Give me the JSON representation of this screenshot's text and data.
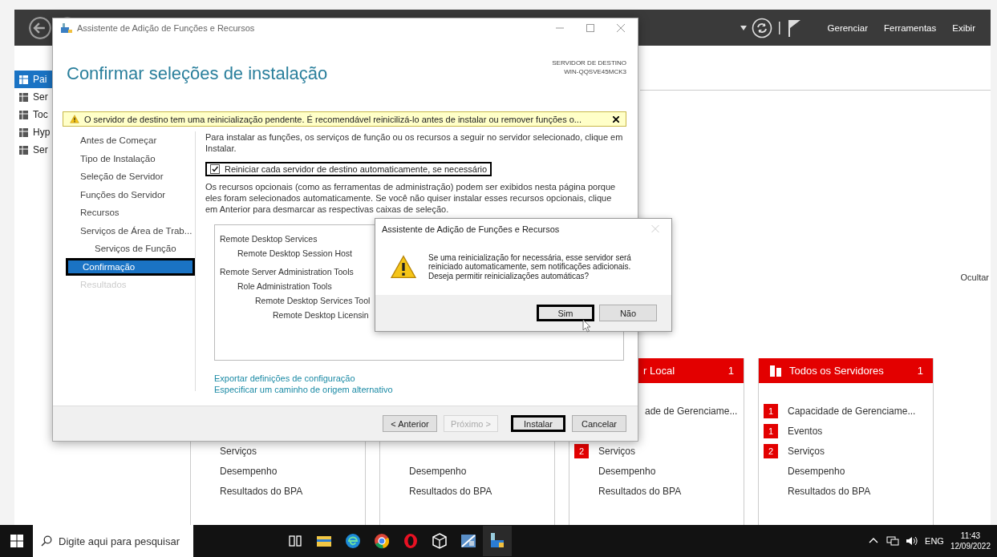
{
  "server_manager": {
    "menu": [
      "Gerenciar",
      "Ferramentas",
      "Exibir"
    ],
    "sidebar_items": [
      {
        "label": "Pai",
        "selected": true
      },
      {
        "label": "Ser",
        "selected": false
      },
      {
        "label": "Toc",
        "selected": false
      },
      {
        "label": "Hyp",
        "selected": false
      },
      {
        "label": "Ser",
        "selected": false
      }
    ],
    "hide_label": "Ocultar",
    "tiles": [
      {
        "rows": [
          {
            "label": "Serviços"
          },
          {
            "label": "Desempenho"
          },
          {
            "label": "Resultados do BPA"
          }
        ]
      },
      {
        "rows": [
          {
            "label": "Desempenho"
          },
          {
            "label": "Resultados do BPA"
          }
        ]
      },
      {
        "title": "r Local",
        "count": "1",
        "cut": true,
        "rows": [
          {
            "label": "ade de Gerenciame...",
            "cut": true
          },
          {
            "label": "Serviços",
            "count": "2"
          },
          {
            "label": "Desempenho"
          },
          {
            "label": "Resultados do BPA"
          }
        ]
      },
      {
        "title": "Todos os Servidores",
        "count": "1",
        "cut": false,
        "rows": [
          {
            "label": "Capacidade de Gerenciame...",
            "count": "1"
          },
          {
            "label": "Eventos",
            "count": "1"
          },
          {
            "label": "Serviços",
            "count": "2"
          },
          {
            "label": "Desempenho"
          },
          {
            "label": "Resultados do BPA"
          }
        ]
      }
    ]
  },
  "wizard": {
    "title": "Assistente de Adição de Funções e Recursos",
    "heading": "Confirmar seleções de instalação",
    "destination_label": "SERVIDOR DE DESTINO",
    "destination_server": "WIN-QQSVE45MCK3",
    "warning": "O servidor de destino tem uma reinicialização pendente. É recomendável reinicilizá-lo antes de instalar ou remover funções o...",
    "nav": [
      {
        "label": "Antes de Começar",
        "selected": false,
        "disabled": false,
        "highlighted": false
      },
      {
        "label": "Tipo de Instalação",
        "selected": false,
        "disabled": false,
        "highlighted": false
      },
      {
        "label": "Seleção de Servidor",
        "selected": false,
        "disabled": false,
        "highlighted": false
      },
      {
        "label": "Funções do Servidor",
        "selected": false,
        "disabled": false,
        "highlighted": false
      },
      {
        "label": "Recursos",
        "selected": false,
        "disabled": false,
        "highlighted": false
      },
      {
        "label": "Serviços de Área de Trab...",
        "selected": false,
        "disabled": false,
        "highlighted": false,
        "children": [
          {
            "label": "Serviços de Função",
            "selected": false,
            "disabled": false,
            "highlighted": false
          }
        ]
      },
      {
        "label": "Confirmação",
        "selected": true,
        "disabled": false,
        "highlighted": true
      },
      {
        "label": "Resultados",
        "selected": false,
        "disabled": true,
        "highlighted": false
      }
    ],
    "intro": "Para instalar as funções, os serviços de função ou os recursos a seguir no servidor selecionado, clique em Instalar.",
    "restart_option": {
      "label": "Reiniciar cada servidor de destino automaticamente, se necessário",
      "checked": true,
      "highlighted": true
    },
    "optional_note": "Os recursos opcionais (como as ferramentas de administração) podem ser exibidos nesta página porque eles foram selecionados automaticamente. Se você não quiser instalar esses recursos opcionais, clique em Anterior para desmarcar as respectivas caixas de seleção.",
    "selections": [
      {
        "label": "Remote Desktop Services",
        "children": [
          {
            "label": "Remote Desktop Session Host"
          }
        ]
      },
      {
        "label": "Remote Server Administration Tools",
        "children": [
          {
            "label": "Role Administration Tools",
            "children": [
              {
                "label": "Remote Desktop Services Tool",
                "children": [
                  {
                    "label": "Remote Desktop Licensin"
                  }
                ]
              }
            ]
          }
        ]
      }
    ],
    "links": [
      "Exportar definições de configuração",
      "Especificar um caminho de origem alternativo"
    ],
    "buttons": [
      {
        "label": "< Anterior",
        "disabled": false,
        "highlighted": false
      },
      {
        "label": "Próximo >",
        "disabled": true,
        "highlighted": false
      },
      {
        "label": "Instalar",
        "disabled": false,
        "highlighted": true
      },
      {
        "label": "Cancelar",
        "disabled": false,
        "highlighted": false
      }
    ]
  },
  "dialog": {
    "title": "Assistente de Adição de Funções e Recursos",
    "message": [
      "Se uma reinicialização for necessária, esse servidor será",
      "reiniciado automaticamente, sem notificações adicionais.",
      "Deseja permitir reinicializações automáticas?"
    ],
    "buttons": [
      {
        "label": "Sim",
        "highlighted": true
      },
      {
        "label": "Não",
        "highlighted": false
      }
    ]
  },
  "taskbar": {
    "search": {
      "placeholder": "Digite aqui para pesquisar"
    },
    "language": "ENG",
    "time": "11:43",
    "date": "12/09/2022"
  }
}
